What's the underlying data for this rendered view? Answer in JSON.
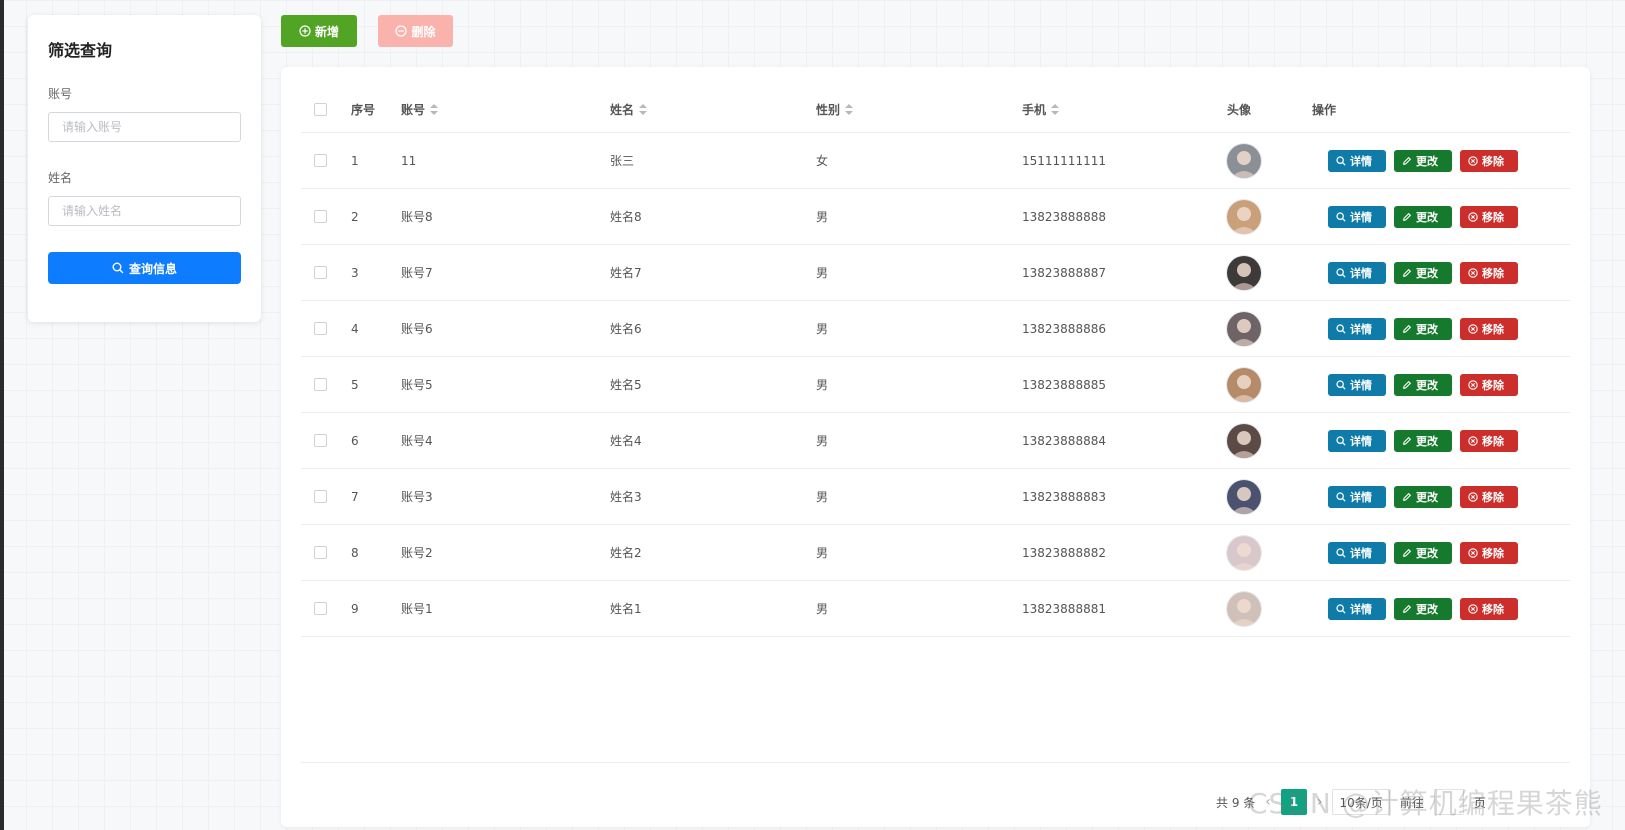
{
  "filter": {
    "title": "筛选查询",
    "account_label": "账号",
    "account_placeholder": "请输入账号",
    "name_label": "姓名",
    "name_placeholder": "请输入姓名",
    "query_label": "查询信息"
  },
  "toolbar": {
    "add_label": "新增",
    "delete_label": "删除"
  },
  "table": {
    "headers": {
      "index": "序号",
      "account": "账号",
      "name": "姓名",
      "gender": "性别",
      "phone": "手机",
      "avatar": "头像",
      "ops": "操作"
    },
    "op_labels": {
      "detail": "详情",
      "edit": "更改",
      "remove": "移除"
    },
    "rows": [
      {
        "index": "1",
        "account": "11",
        "name": "张三",
        "gender": "女",
        "phone": "15111111111",
        "avatar_color": "#8a9096"
      },
      {
        "index": "2",
        "account": "账号8",
        "name": "姓名8",
        "gender": "男",
        "phone": "13823888888",
        "avatar_color": "#c9a07a"
      },
      {
        "index": "3",
        "account": "账号7",
        "name": "姓名7",
        "gender": "男",
        "phone": "13823888887",
        "avatar_color": "#3e3a3a"
      },
      {
        "index": "4",
        "account": "账号6",
        "name": "姓名6",
        "gender": "男",
        "phone": "13823888886",
        "avatar_color": "#6e6468"
      },
      {
        "index": "5",
        "account": "账号5",
        "name": "姓名5",
        "gender": "男",
        "phone": "13823888885",
        "avatar_color": "#b58b6a"
      },
      {
        "index": "6",
        "account": "账号4",
        "name": "姓名4",
        "gender": "男",
        "phone": "13823888884",
        "avatar_color": "#5b4a45"
      },
      {
        "index": "7",
        "account": "账号3",
        "name": "姓名3",
        "gender": "男",
        "phone": "13823888883",
        "avatar_color": "#4b5270"
      },
      {
        "index": "8",
        "account": "账号2",
        "name": "姓名2",
        "gender": "男",
        "phone": "13823888882",
        "avatar_color": "#d8c8cc"
      },
      {
        "index": "9",
        "account": "账号1",
        "name": "姓名1",
        "gender": "男",
        "phone": "13823888881",
        "avatar_color": "#cfc0ba"
      }
    ]
  },
  "pagination": {
    "total": "共 9 条",
    "current_page": "1",
    "page_size": "10条/页",
    "goto_label": "前往",
    "page_suffix": "页"
  },
  "watermark": "CSDN @计算机编程果茶熊",
  "colors": {
    "primary": "#0d7cff",
    "add": "#52a524",
    "delete": "#f9b3ac",
    "detail": "#0e7ba8",
    "edit": "#167a2e",
    "remove": "#cc2f2b",
    "page_active": "#10a383"
  }
}
